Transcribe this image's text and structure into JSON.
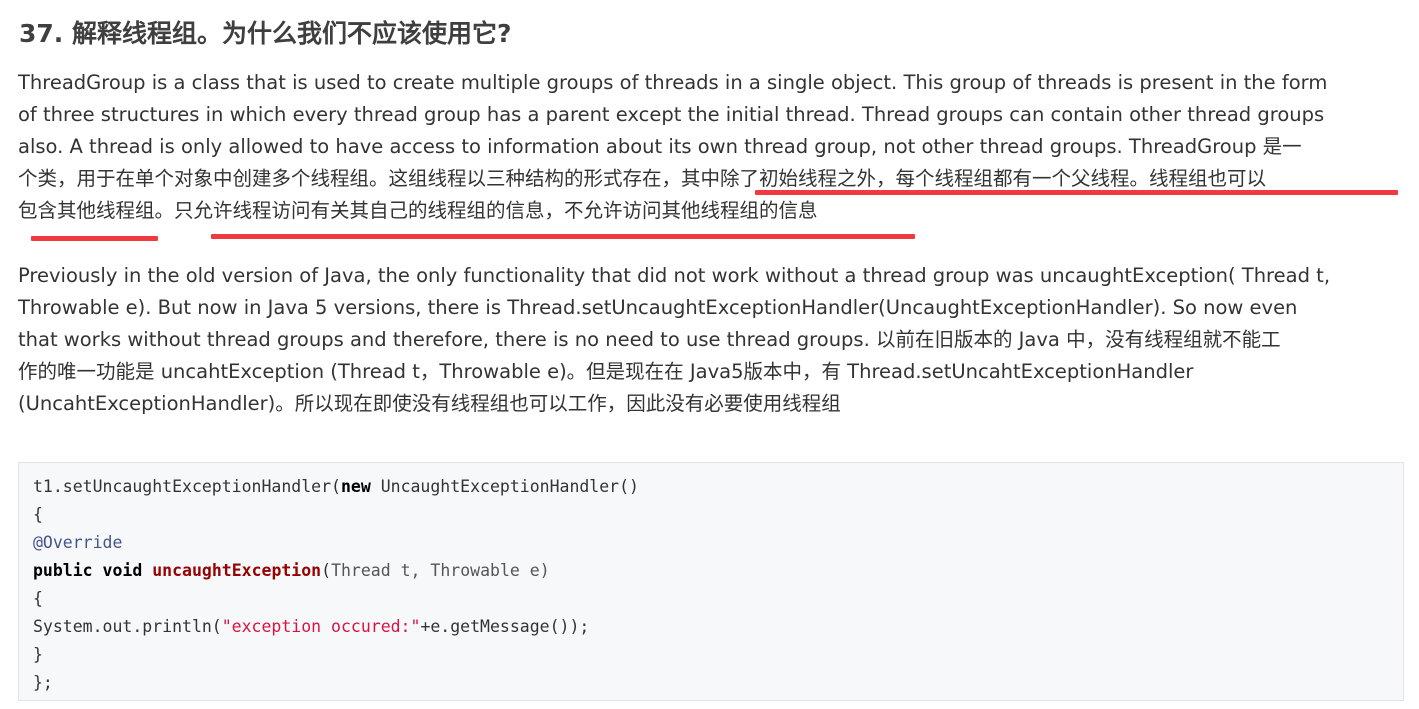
{
  "heading": "37. 解释线程组。为什么我们不应该使用它?",
  "paragraph1": {
    "lines": [
      "ThreadGroup is a class that is used to create multiple groups of threads in a single object. This group of threads is present in the form",
      "of three structures in which every thread group has a parent except the initial thread. Thread groups can contain other thread groups",
      "also. A thread is only allowed to have access to information about its own thread group, not other thread groups.    ThreadGroup 是一",
      "个类，用于在单个对象中创建多个线程组。这组线程以三种结构的形式存在，其中除了初始线程之外，每个线程组都有一个父线程。线程组也可以",
      "包含其他线程组。只允许线程访问有关其自己的线程组的信息，不允许访问其他线程组的信息"
    ]
  },
  "paragraph2": {
    "lines": [
      "Previously in the old version of Java, the only functionality that did not work without a thread group was uncaughtException( Thread t,",
      "Throwable e). But now in Java 5 versions, there is Thread.setUncaughtExceptionHandler(UncaughtExceptionHandler). So now even",
      "that works without thread groups and therefore, there is no need to use thread groups.     以前在旧版本的 Java 中，没有线程组就不能工",
      "作的唯一功能是 uncahtException (Thread t，Throwable e)。但是现在在 Java5版本中，有 Thread.setUncahtExceptionHandler",
      "(UncahtExceptionHandler)。所以现在即使没有线程组也可以工作，因此没有必要使用线程组"
    ]
  },
  "code": {
    "line1": {
      "a": "t1.setUncaughtExceptionHandler(",
      "kw": "new",
      "b": " UncaughtExceptionHandler()"
    },
    "line2": "{",
    "line3": "@Override",
    "line4": {
      "kw1": "public",
      "kw2": "void",
      "fn": "uncaughtException",
      "p1": "(",
      "t1": "Thread",
      "v1": " t, ",
      "t2": "Throwable",
      "v2": " e)"
    },
    "line5": "{",
    "line6": {
      "a": "System.out.println(",
      "str": "\"exception occured:\"",
      "b": "+e.getMessage());"
    },
    "line7": "}",
    "line8": "};"
  },
  "colors": {
    "underline": "#f03a3f",
    "code_background": "#f6f8fa",
    "keyword": "#000000",
    "function_name": "#990000",
    "annotation": "#445588",
    "string": "#dd1144"
  }
}
